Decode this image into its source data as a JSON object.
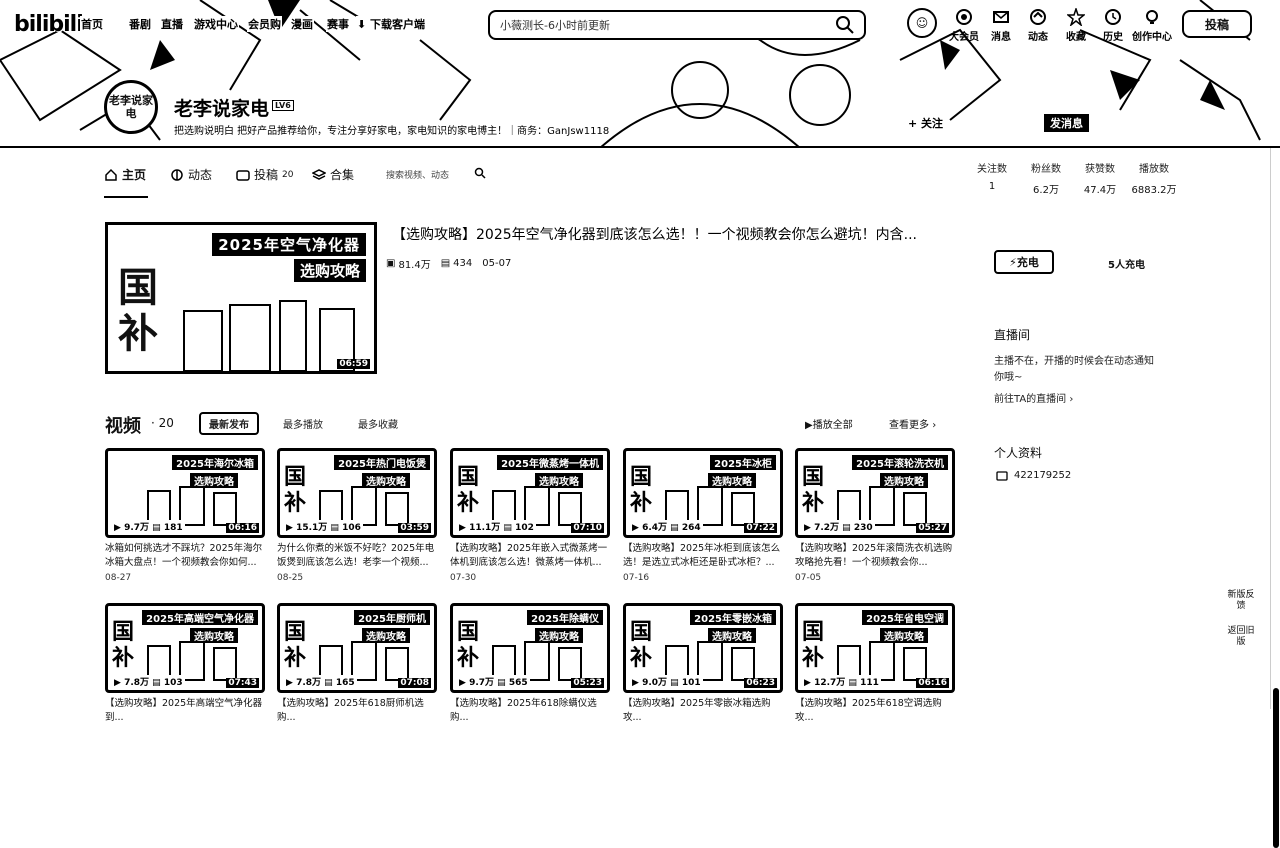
{
  "topbar": {
    "logo": "bilibili",
    "nav": [
      "首页",
      "番剧",
      "直播",
      "游戏中心",
      "会员购",
      "漫画",
      "赛事",
      "下载客户端"
    ],
    "search_placeholder": "小薇测长-6小时前更新",
    "icons": [
      {
        "label": "大会员",
        "icon": "vip-icon"
      },
      {
        "label": "消息",
        "icon": "message-icon"
      },
      {
        "label": "动态",
        "icon": "dynamic-icon"
      },
      {
        "label": "收藏",
        "icon": "star-icon"
      },
      {
        "label": "历史",
        "icon": "clock-icon"
      },
      {
        "label": "创作中心",
        "icon": "bulb-icon"
      }
    ],
    "upload": "投稿"
  },
  "uploader": {
    "avatar_text": "老李说家电",
    "name": "老李说家电",
    "level": "LV6",
    "sign": "把选购说明白  把好产品推荐给你，专注分享好家电，家电知识的家电博主！｜商务：GanJsw1118",
    "follow": "+ 关注",
    "message": "发消息"
  },
  "subnav": {
    "tabs": [
      {
        "label": "主页",
        "count": ""
      },
      {
        "label": "动态",
        "count": ""
      },
      {
        "label": "投稿",
        "count": "20"
      },
      {
        "label": "合集",
        "count": ""
      }
    ],
    "search_placeholder": "搜索视频、动态"
  },
  "stats": [
    {
      "label": "关注数",
      "value": "1"
    },
    {
      "label": "粉丝数",
      "value": "6.2万"
    },
    {
      "label": "获赞数",
      "value": "47.4万"
    },
    {
      "label": "播放数",
      "value": "6883.2万"
    }
  ],
  "featured": {
    "title": "【选购攻略】2025年空气净化器到底该怎么选！！一个视频教会你怎么避坑！内含...",
    "thumb_line1": "2025年空气净化器",
    "thumb_line2": "选购攻略",
    "thumb_big": "国补",
    "duration": "06:59",
    "plays": "81.4万",
    "comments": "434",
    "date": "05-07"
  },
  "videos_header": {
    "title": "视频",
    "count": "20",
    "sorts": [
      "最新发布",
      "最多播放",
      "最多收藏"
    ],
    "play_all": "播放全部",
    "more": "查看更多"
  },
  "videos": [
    {
      "line1": "2025年海尔冰箱",
      "line2": "选购攻略",
      "big": "",
      "plays": "9.7万",
      "comments": "181",
      "duration": "06:16",
      "title": "冰箱如何挑选才不踩坑？2025年海尔冰箱大盘点！一个视频教会你如何...",
      "date": "08-27"
    },
    {
      "line1": "2025年热门电饭煲",
      "line2": "选购攻略",
      "big": "国补",
      "plays": "15.1万",
      "comments": "106",
      "duration": "03:59",
      "title": "为什么你煮的米饭不好吃？2025年电饭煲到底该怎么选！老李一个视频...",
      "date": "08-25"
    },
    {
      "line1": "2025年微蒸烤一体机",
      "line2": "选购攻略",
      "big": "国补",
      "plays": "11.1万",
      "comments": "102",
      "duration": "07:10",
      "title": "【选购攻略】2025年嵌入式微蒸烤一体机到底该怎么选！微蒸烤一体机...",
      "date": "07-30"
    },
    {
      "line1": "2025年冰柜",
      "line2": "选购攻略",
      "big": "国补",
      "plays": "6.4万",
      "comments": "264",
      "duration": "07:22",
      "title": "【选购攻略】2025年冰柜到底该怎么选！是选立式冰柜还是卧式冰柜？...",
      "date": "07-16"
    },
    {
      "line1": "2025年滚轮洗衣机",
      "line2": "选购攻略",
      "big": "国补",
      "plays": "7.2万",
      "comments": "230",
      "duration": "05:27",
      "title": "【选购攻略】2025年滚筒洗衣机选购攻略抢先看！一个视频教会你...",
      "date": "07-05"
    },
    {
      "line1": "2025年高端空气净化器",
      "line2": "选购攻略",
      "big": "国补",
      "plays": "7.8万",
      "comments": "103",
      "duration": "07:43",
      "title": "【选购攻略】2025年高端空气净化器到...",
      "date": ""
    },
    {
      "line1": "2025年厨师机",
      "line2": "选购攻略",
      "big": "国补",
      "plays": "7.8万",
      "comments": "165",
      "duration": "07:08",
      "title": "【选购攻略】2025年618厨师机选购...",
      "date": ""
    },
    {
      "line1": "2025年除螨仪",
      "line2": "选购攻略",
      "big": "国补",
      "plays": "9.7万",
      "comments": "565",
      "duration": "05:23",
      "title": "【选购攻略】2025年618除螨仪选购...",
      "date": ""
    },
    {
      "line1": "2025年零嵌冰箱",
      "line2": "选购攻略",
      "big": "国补",
      "plays": "9.0万",
      "comments": "101",
      "duration": "06:23",
      "title": "【选购攻略】2025年零嵌冰箱选购攻...",
      "date": ""
    },
    {
      "line1": "2025年省电空调",
      "line2": "选购攻略",
      "big": "国补",
      "plays": "12.7万",
      "comments": "111",
      "duration": "06:16",
      "title": "【选购攻略】2025年618空调选购攻...",
      "date": ""
    }
  ],
  "sidebar": {
    "charge_label": "充电",
    "charge_count": "5人充电",
    "live_title": "直播间",
    "live_desc": "主播不在，开播的时候会在动态通知你哦~",
    "live_link": "前往TA的直播间 ›",
    "profile_title": "个人资料",
    "uid": "422179252"
  },
  "floating": {
    "new_feedback": "新版反馈",
    "back_old": "返回旧版"
  }
}
